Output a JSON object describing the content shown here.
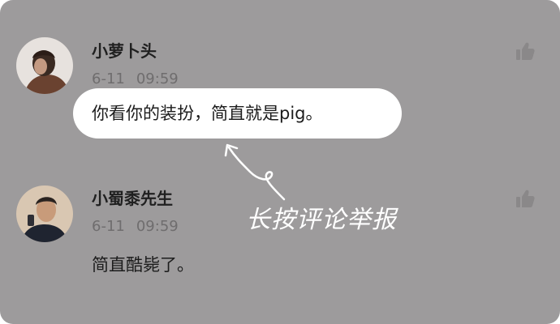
{
  "comments": [
    {
      "username": "小萝卜头",
      "date": "6-11",
      "time": "09:59",
      "text": "你看你的装扮，简直就是pig。",
      "avatar_icon": "user-avatar-photo",
      "like_icon": "thumbs-up-icon"
    },
    {
      "username": "小蜀黍先生",
      "date": "6-11",
      "time": "09:59",
      "text": "简直酷毙了。",
      "avatar_icon": "user-avatar-photo",
      "like_icon": "thumbs-up-icon"
    }
  ],
  "hint": {
    "label": "长按评论举报",
    "icon": "curved-arrow-icon"
  },
  "colors": {
    "overlay": "#9d9b9c",
    "bubble": "#ffffff",
    "text": "#1c1c1c",
    "meta": "#6f6d6e",
    "hint": "#ffffff"
  }
}
